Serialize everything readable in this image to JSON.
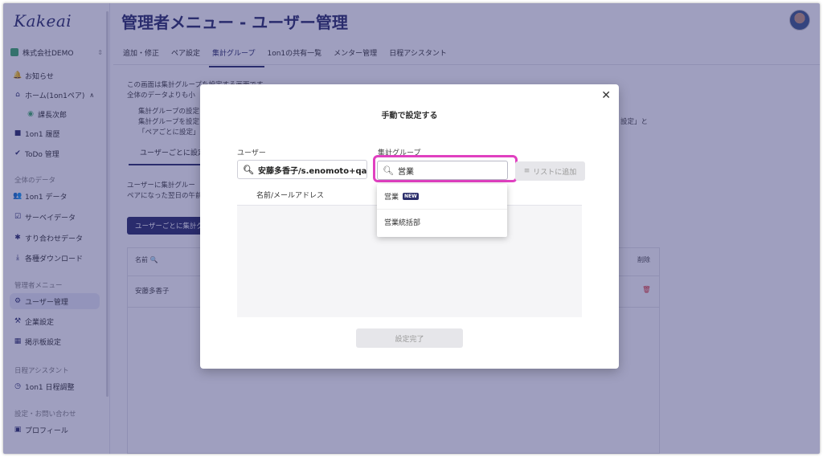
{
  "app": {
    "logo": "Kakeai",
    "page_title": "管理者メニュー - ユーザー管理"
  },
  "sidebar": {
    "company": "株式会社DEMO",
    "items": [
      {
        "label": "お知らせ"
      },
      {
        "label": "ホーム(1on1ペア)"
      },
      {
        "label": "課長次郎"
      },
      {
        "label": "1on1 履歴"
      },
      {
        "label": "ToDo 管理"
      }
    ],
    "section_data": "全体のデータ",
    "data_items": [
      {
        "label": "1on1 データ"
      },
      {
        "label": "サーベイデータ"
      },
      {
        "label": "すり合わせデータ"
      },
      {
        "label": "各種ダウンロード"
      }
    ],
    "section_admin": "管理者メニュー",
    "admin_items": [
      {
        "label": "ユーザー管理"
      },
      {
        "label": "企業設定"
      },
      {
        "label": "掲示板設定"
      }
    ],
    "section_schedule": "日程アシスタント",
    "schedule_items": [
      {
        "label": "1on1 日程調整"
      }
    ],
    "section_settings": "設定・お問い合わせ",
    "settings_items": [
      {
        "label": "プロフィール"
      }
    ]
  },
  "tabs": [
    "追加・修正",
    "ペア設定",
    "集計グループ",
    "1on1の共有一覧",
    "メンター管理",
    "日程アシスタント"
  ],
  "background": {
    "desc1": "この画面は集計グループを設定する画面です。",
    "desc2": "全体のデータよりも小",
    "desc3": "集計グループの設定",
    "desc4": "集計グループを設定",
    "desc5": "「ペアごとに設定」",
    "desc_right": "設定」と",
    "subtab": "ユーザーごとに設定",
    "desc6": "ユーザーに集計グルー",
    "desc7": "ペアになった翌日の午前",
    "button": "ユーザーごとに集計グ",
    "col_name": "名前",
    "col_delete": "削除",
    "row_name": "安藤多香子"
  },
  "modal": {
    "title": "手動で設定する",
    "user_label": "ユーザー",
    "user_value": "安藤多香子/s.enomoto+qa",
    "group_label": "集計グループ",
    "group_value": "営業",
    "add_button": "リストに追加",
    "list_header": "名前/メールアドレス",
    "done_button": "設定完了",
    "dropdown": [
      {
        "label": "営業",
        "badge": "NEW"
      },
      {
        "label": "営業統括部"
      }
    ]
  },
  "colors": {
    "accent": "#2b2e6b",
    "highlight": "#e040c0",
    "overlay": "#2a2a70"
  }
}
